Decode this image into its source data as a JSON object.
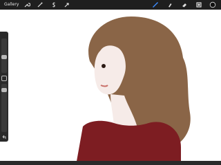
{
  "app": {
    "gallery_label": "Gallery",
    "toolbar_left_icons": [
      "wrench-icon",
      "magic-wand-icon",
      "selection-icon",
      "transform-arrow-icon"
    ],
    "toolbar_right_icons": [
      "brush-icon",
      "smudge-icon",
      "eraser-icon",
      "layers-icon",
      "color-swatch-icon"
    ],
    "active_tool": "brush",
    "active_color": "#111111",
    "accent_color": "#3c8cff"
  },
  "sidebar": {
    "brush_size_slider": 0.25,
    "opacity_slider": 0.3,
    "buttons": [
      "modify-button",
      "undo-button",
      "redo-button"
    ]
  },
  "artwork": {
    "subject": "portrait",
    "hair_color": "#8a6547",
    "skin_color": "#f6ebe8",
    "shirt_color": "#7d1d22"
  }
}
